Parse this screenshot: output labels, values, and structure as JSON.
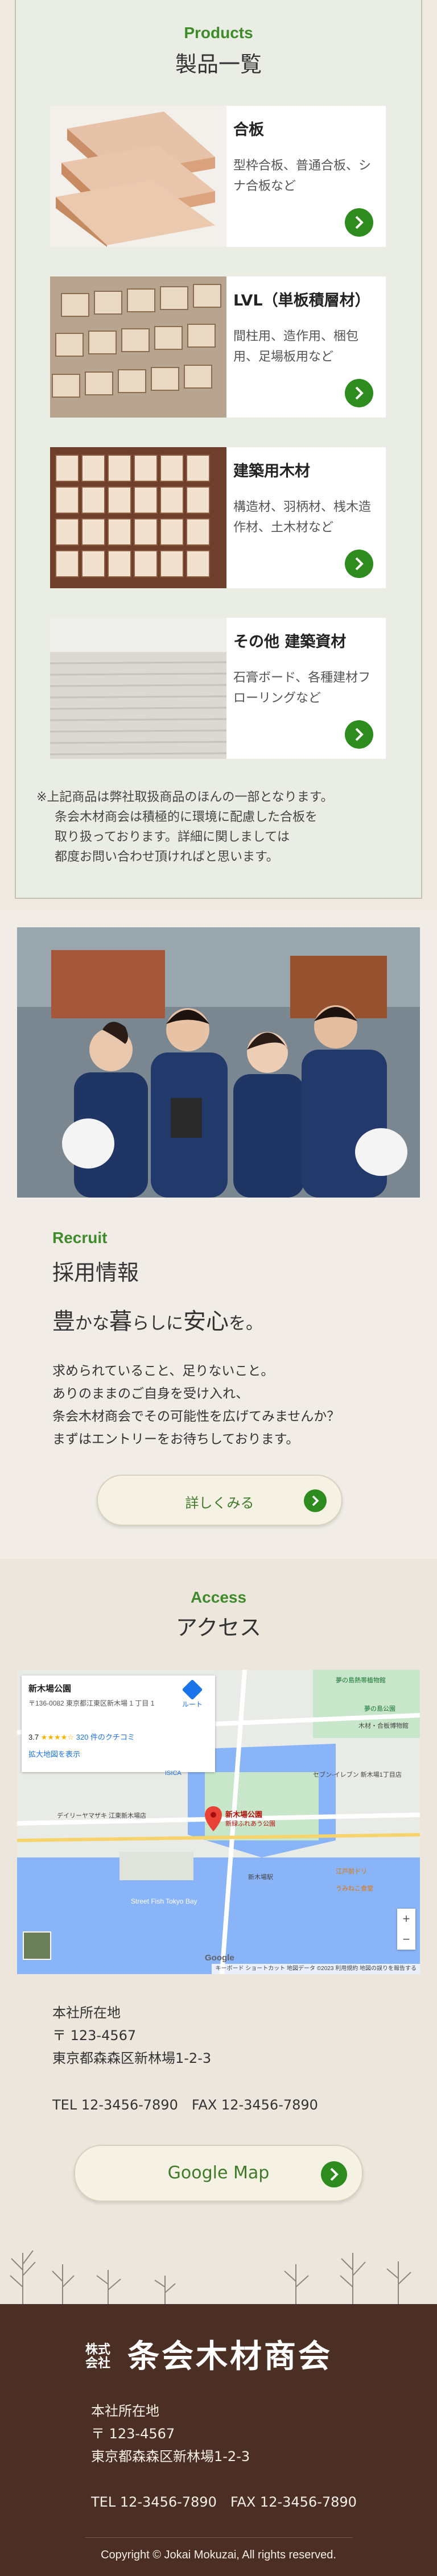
{
  "products": {
    "heading_en": "Products",
    "heading_jp": "製品一覧",
    "items": [
      {
        "title": "合板",
        "desc": "型枠合板、普通合板、シナ合板など"
      },
      {
        "title": "LVL（単板積層材）",
        "desc": "間柱用、造作用、梱包用、足場板用など"
      },
      {
        "title": "建築用木材",
        "desc": "構造材、羽柄材、桟木造作材、土木材など"
      },
      {
        "title": "その他 建築資材",
        "desc": "石膏ボード、各種建材フローリングなど"
      }
    ],
    "note_lines": [
      "※上記商品は弊社取扱商品のほんの一部となります。",
      "条会木材商会は積極的に環境に配慮した合板を",
      "取り扱っております。詳細に関しましては",
      "都度お問い合わせ頂ければと思います。"
    ]
  },
  "recruit": {
    "heading_en": "Recruit",
    "heading_jp": "採用情報",
    "catch": {
      "a": "豊",
      "b": "かな",
      "c": "暮",
      "d": "らしに",
      "e": "安心",
      "f": "を。"
    },
    "body_lines": [
      "求められていること、足りないこと。",
      "ありのままのご自身を受け入れ、",
      "条会木材商会でその可能性を広げてみませんか？",
      "まずはエントリーをお待ちしております。"
    ],
    "more_label": "詳しくみる"
  },
  "access": {
    "heading_en": "Access",
    "heading_jp": "アクセス",
    "map": {
      "place_name": "新木場公園",
      "place_address": "〒136-0082 東京都江東区新木場 1 丁目 1",
      "rating": "3.7",
      "stars": "★★★★☆",
      "reviews": "320 件のクチコミ",
      "route": "ルート",
      "enlarge": "拡大地図を表示",
      "pin_label": "新木場公園",
      "pin_sub": "新緑ふれあう公園",
      "labels": [
        "夢の島熱帯植物館",
        "セブン-イレブン 新木場1丁目店",
        "ISICA",
        "新木場駅",
        "デイリーヤマザキ 江東新木場店",
        "うみねこ食堂",
        "江戸前ドリ",
        "Street Fish Tokyo Bay",
        "夢の島公園",
        "木材・合板博物館"
      ],
      "zoom_in": "+",
      "zoom_out": "−",
      "google": "Google",
      "footer_text": "キーボード ショートカット  地図データ ©2023  利用規約  地図の誤りを報告する"
    },
    "address_label": "本社所在地",
    "zip": "〒 123-4567",
    "address": "東京都森森区新林場1-2-3",
    "tel_fax": "TEL 12-3456-7890　FAX 12-3456-7890",
    "googlemap_label": "Google Map"
  },
  "footer": {
    "company_name": "株式会社 条会木材商会",
    "logo_small": "株式会社",
    "logo_main": "条会木材商会",
    "address_label": "本社所在地",
    "zip": "〒 123-4567",
    "address": "東京都森森区新林場1-2-3",
    "tel_fax": "TEL 12-3456-7890　FAX 12-3456-7890",
    "copyright": "Copyright © Jokai Mokuzai, All rights reserved."
  },
  "colors": {
    "accent_green": "#2e8b1e",
    "heading_green": "#3f8a2a",
    "footer_brown": "#4b2e24"
  }
}
